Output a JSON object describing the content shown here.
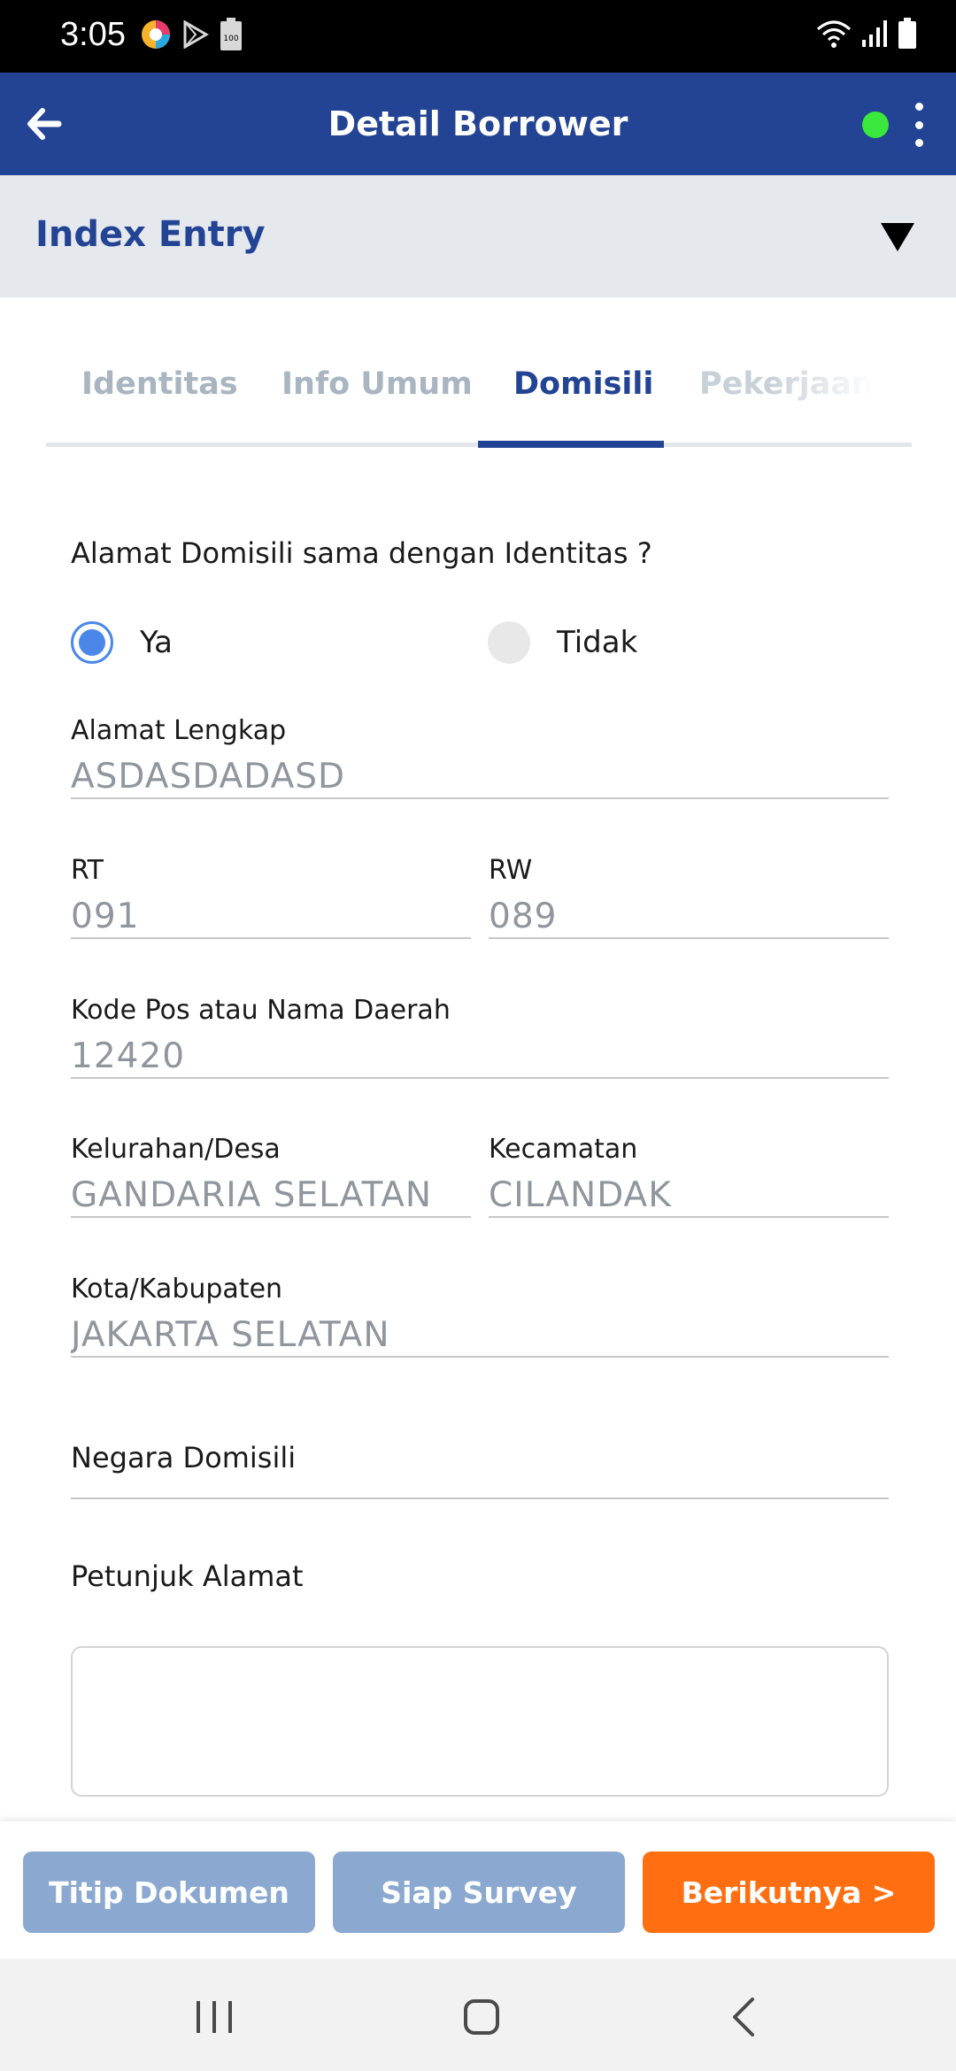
{
  "status_bar": {
    "time": "3:05",
    "battery_badge": "100",
    "icons": [
      "app-circle-icon",
      "play-store-icon",
      "battery-saver-icon",
      "wifi-icon",
      "signal-icon",
      "battery-icon"
    ]
  },
  "app_bar": {
    "title": "Detail Borrower",
    "status_color": "#39e83a",
    "background_color": "#234394"
  },
  "section": {
    "title": "Index Entry"
  },
  "tabs": [
    {
      "label": "Identitas",
      "active": false
    },
    {
      "label": "Info Umum",
      "active": false
    },
    {
      "label": "Domisili",
      "active": true
    },
    {
      "label": "Pekerjaan",
      "active": false
    }
  ],
  "form": {
    "question": "Alamat Domisili sama dengan Identitas ?",
    "options": [
      {
        "label": "Ya",
        "selected": true
      },
      {
        "label": "Tidak",
        "selected": false
      }
    ],
    "alamat_lengkap": {
      "label": "Alamat Lengkap",
      "value": "ASDASDADASD"
    },
    "rt": {
      "label": "RT",
      "value": "091"
    },
    "rw": {
      "label": "RW",
      "value": "089"
    },
    "kode_pos": {
      "label": "Kode Pos atau Nama Daerah",
      "value": "12420"
    },
    "kelurahan": {
      "label": "Kelurahan/Desa",
      "value": "GANDARIA SELATAN"
    },
    "kecamatan": {
      "label": "Kecamatan",
      "value": "CILANDAK"
    },
    "kota": {
      "label": "Kota/Kabupaten",
      "value": "JAKARTA SELATAN"
    },
    "negara": {
      "label": "Negara Domisili",
      "value": ""
    },
    "petunjuk": {
      "label": "Petunjuk Alamat",
      "value": ""
    }
  },
  "actions": {
    "titip": "Titip Dokumen",
    "siap": "Siap Survey",
    "next": "Berikutnya >"
  },
  "colors": {
    "primary": "#234394",
    "accent": "#ff6f11",
    "disabled_button": "#8ba9d0",
    "radio": "#4a87e8"
  }
}
